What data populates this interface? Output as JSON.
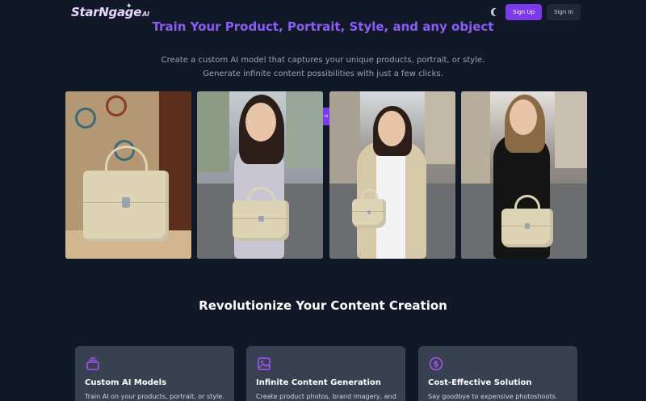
{
  "header": {
    "logo_text": "StarNgage",
    "logo_suffix": "AI",
    "signup_label": "Sign Up",
    "signin_label": "Sign In"
  },
  "hero": {
    "title": "Train Your Product, Portrait, Style, and any object",
    "subtitle_line1": "Create a custom AI model that captures your unique products, portrait, or style.",
    "subtitle_line2": "Generate infinite content possibilities with just a few clicks.",
    "overlay_badge": "ni"
  },
  "gallery": {
    "images": [
      {
        "name": "handbag-product-shot"
      },
      {
        "name": "woman-with-handbag-street-1"
      },
      {
        "name": "woman-in-blazer-with-handbag"
      },
      {
        "name": "woman-in-black-with-handbag"
      }
    ]
  },
  "features": {
    "title": "Revolutionize Your Content Creation",
    "cards": [
      {
        "icon": "stack-icon",
        "title": "Custom AI Models",
        "desc": "Train AI on your products, portrait, or style."
      },
      {
        "icon": "image-icon",
        "title": "Infinite Content Generation",
        "desc": "Create product photos, brand imagery, and"
      },
      {
        "icon": "dollar-icon",
        "title": "Cost-Effective Solution",
        "desc": "Say goodbye to expensive photoshoots."
      }
    ]
  },
  "colors": {
    "background": "#111827",
    "accent": "#7c3aed",
    "hero_title": "#8b5cf6",
    "card": "#374151"
  }
}
